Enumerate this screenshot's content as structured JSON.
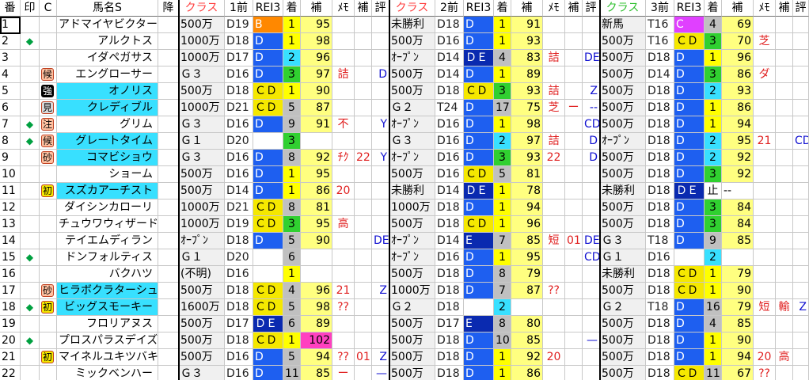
{
  "sheet": {
    "header": [
      "番",
      "印",
      "C",
      "馬名S",
      "降",
      "クラス",
      "1前",
      "REI3",
      "着",
      "補",
      "ﾒﾓ",
      "補",
      "評",
      "クラス",
      "2前",
      "REI3",
      "着",
      "補",
      "ﾒﾓ",
      "補",
      "評",
      "クラス",
      "3前",
      "REI3",
      "着",
      "補",
      "ﾒﾓ",
      "補",
      "評"
    ],
    "rows": [
      [
        "1",
        "",
        "",
        "アドマイヤビクター",
        "",
        "500万",
        "D19",
        "B",
        "1",
        "95",
        "",
        "",
        "",
        "未勝利",
        "D18",
        "D",
        "1",
        "91",
        "",
        "",
        "",
        "新馬",
        "T16",
        "C",
        "4",
        "69",
        "",
        "",
        ""
      ],
      [
        "2",
        "◆",
        "",
        "アルクトス",
        "",
        "1000万",
        "D18",
        "D",
        "1",
        "98",
        "",
        "",
        "",
        "500万",
        "D16",
        "D",
        "1",
        "93",
        "",
        "",
        "",
        "500万",
        "T16",
        "ＣＤ",
        "3",
        "70",
        "芝",
        "",
        ""
      ],
      [
        "3",
        "",
        "",
        "イダペガサス",
        "",
        "1000万",
        "D17",
        "D",
        "2",
        "96",
        "",
        "",
        "",
        "ｵｰﾌﾟﾝ",
        "D14",
        "ＤＥ",
        "4",
        "83",
        "詰",
        "",
        "DE",
        "500万",
        "D18",
        "D",
        "1",
        "96",
        "",
        "",
        ""
      ],
      [
        "4",
        "",
        "候",
        "エングローサー",
        "",
        "Ｇ３",
        "D16",
        "D",
        "3",
        "97",
        "詰",
        "",
        "D",
        "500万",
        "D14",
        "D",
        "1",
        "89",
        "",
        "",
        "",
        "500万",
        "D14",
        "D",
        "3",
        "86",
        "ダ",
        "",
        ""
      ],
      [
        "5",
        "",
        "強",
        "オノリス",
        "",
        "500万",
        "D18",
        "ＣＤ",
        "1",
        "90",
        "",
        "",
        "",
        "500万",
        "D18",
        "ＣＤ",
        "3",
        "93",
        "詰",
        "",
        "Z",
        "500万",
        "D18",
        "D",
        "2",
        "93",
        "",
        "",
        ""
      ],
      [
        "6",
        "",
        "見",
        "クレディブル",
        "",
        "1000万",
        "D21",
        "ＣＤ",
        "5",
        "87",
        "",
        "",
        "",
        "Ｇ２",
        "T24",
        "D",
        "17",
        "75",
        "芝",
        "ー",
        "--",
        "500万",
        "D18",
        "D",
        "1",
        "86",
        "",
        "",
        ""
      ],
      [
        "7",
        "◆",
        "注",
        "グリム",
        "",
        "Ｇ３",
        "D16",
        "D",
        "9",
        "91",
        "不",
        "",
        "Y",
        "ｵｰﾌﾟﾝ",
        "D16",
        "D",
        "1",
        "98",
        "",
        "",
        "CD",
        "500万",
        "D18",
        "D",
        "1",
        "94",
        "",
        "",
        ""
      ],
      [
        "8",
        "◆",
        "候",
        "グレートタイム",
        "",
        "Ｇ１",
        "D20",
        "",
        "3",
        "",
        "",
        "",
        "",
        "Ｇ３",
        "D16",
        "D",
        "2",
        "97",
        "詰",
        "",
        "D",
        "ｵｰﾌﾟﾝ",
        "D18",
        "D",
        "2",
        "95",
        "21",
        "",
        "CD"
      ],
      [
        "9",
        "",
        "砂",
        "コマビショウ",
        "",
        "Ｇ３",
        "D16",
        "D",
        "8",
        "92",
        "ﾁｸ",
        "22",
        "Y",
        "ｵｰﾌﾟﾝ",
        "D16",
        "D",
        "3",
        "93",
        "22",
        "",
        "D",
        "500万",
        "D18",
        "D",
        "2",
        "92",
        "",
        "",
        ""
      ],
      [
        "10",
        "",
        "",
        "ショーム",
        "",
        "500万",
        "D16",
        "D",
        "1",
        "95",
        "",
        "",
        "",
        "500万",
        "D16",
        "ＣＤ",
        "5",
        "81",
        "",
        "",
        "",
        "500万",
        "D18",
        "D",
        "3",
        "92",
        "",
        "",
        ""
      ],
      [
        "11",
        "",
        "初",
        "スズカアーチスト",
        "",
        "500万",
        "D14",
        "D",
        "1",
        "86",
        "20",
        "",
        "",
        "未勝利",
        "D14",
        "ＤＥ",
        "1",
        "78",
        "",
        "",
        "",
        "未勝利",
        "D18",
        "ＤＥ",
        "止",
        "--",
        "",
        "",
        ""
      ],
      [
        "12",
        "",
        "",
        "ダイシンカローリ",
        "",
        "1000万",
        "D21",
        "ＣＤ",
        "8",
        "81",
        "",
        "",
        "",
        "1000万",
        "D18",
        "D",
        "1",
        "94",
        "",
        "",
        "",
        "500万",
        "D18",
        "D",
        "3",
        "84",
        "",
        "",
        ""
      ],
      [
        "13",
        "",
        "",
        "チュウワウィザード",
        "",
        "1000万",
        "D19",
        "ＣＤ",
        "3",
        "95",
        "高",
        "",
        "",
        "500万",
        "D18",
        "ＣＤ",
        "1",
        "96",
        "",
        "",
        "",
        "500万",
        "D18",
        "D",
        "3",
        "84",
        "",
        "",
        ""
      ],
      [
        "14",
        "",
        "",
        "テイエムディラン",
        "",
        "ｵｰﾌﾟﾝ",
        "D18",
        "D",
        "5",
        "90",
        "",
        "",
        "DE",
        "ｵｰﾌﾟﾝ",
        "D14",
        "E",
        "7",
        "85",
        "短",
        "01",
        "DE",
        "Ｇ３",
        "T18",
        "D",
        "9",
        "85",
        "",
        "",
        ""
      ],
      [
        "15",
        "◆",
        "",
        "ドンフォルティス",
        "",
        "Ｇ１",
        "D20",
        "",
        "6",
        "",
        "",
        "",
        "",
        "ｵｰﾌﾟﾝ",
        "D16",
        "D",
        "1",
        "95",
        "",
        "",
        "CD",
        "Ｇ１",
        "D16",
        "",
        "2",
        "",
        "",
        "",
        ""
      ],
      [
        "16",
        "",
        "",
        "バクハツ",
        "",
        "(不明)",
        "D16",
        "",
        "1",
        "",
        "",
        "",
        "",
        "500万",
        "D18",
        "D",
        "8",
        "79",
        "",
        "",
        "",
        "未勝利",
        "D18",
        "ＣＤ",
        "1",
        "79",
        "",
        "",
        ""
      ],
      [
        "17",
        "",
        "砂",
        "ヒラボクラターシュ",
        "",
        "500万",
        "D18",
        "ＣＤ",
        "4",
        "96",
        "21",
        "",
        "Z",
        "1000万",
        "D18",
        "D",
        "7",
        "87",
        "??",
        "",
        "",
        "500万",
        "D18",
        "ＣＤ",
        "1",
        "90",
        "",
        "",
        ""
      ],
      [
        "18",
        "◆",
        "初",
        "ビッグスモーキー",
        "",
        "1600万",
        "D18",
        "ＣＤ",
        "5",
        "98",
        "??",
        "",
        "",
        "Ｇ２",
        "D18",
        "",
        "2",
        "",
        "",
        "",
        "",
        "Ｇ２",
        "T18",
        "D",
        "16",
        "79",
        "短",
        "輸",
        "Z"
      ],
      [
        "19",
        "",
        "",
        "フロリアヌス",
        "",
        "500万",
        "D17",
        "ＤＥ",
        "6",
        "89",
        "",
        "",
        "",
        "500万",
        "D17",
        "E",
        "8",
        "80",
        "",
        "",
        "",
        "500万",
        "D18",
        "D",
        "4",
        "85",
        "",
        "",
        ""
      ],
      [
        "20",
        "◆",
        "",
        "プロスパラスデイズ",
        "",
        "500万",
        "D18",
        "ＣＤ",
        "1",
        "102",
        "",
        "",
        "",
        "500万",
        "D18",
        "D",
        "10",
        "85",
        "",
        "",
        "—",
        "500万",
        "D18",
        "D",
        "1",
        "90",
        "",
        "",
        ""
      ],
      [
        "21",
        "",
        "初",
        "マイネルユキツバキ",
        "",
        "500万",
        "D16",
        "D",
        "5",
        "94",
        "??",
        "01",
        "Z",
        "500万",
        "D18",
        "D",
        "1",
        "92",
        "20",
        "",
        "",
        "500万",
        "D18",
        "D",
        "1",
        "94",
        "20",
        "高",
        ""
      ],
      [
        "22",
        "",
        "",
        "ミックベンハー",
        "",
        "Ｇ３",
        "D16",
        "D",
        "11",
        "85",
        "ー",
        "",
        "—",
        "500万",
        "D18",
        "D",
        "1",
        "86",
        "",
        "",
        "",
        "500万",
        "D18",
        "ＣＤ",
        "11",
        "67",
        "??",
        "",
        ""
      ]
    ]
  },
  "palette": {
    "class_bg": "#f0f0f0",
    "class_hdr": "#ff4040",
    "rei_D": "#1e5ff0",
    "rei_CD": "#f5e800",
    "rei_DE": "#0a2ab0",
    "rei_E": "#0a2ab0",
    "rei_B": "#ff8800",
    "rei_C": "#e040ff",
    "chaku_1": "#ffff00",
    "chaku_2": "#38e0ff",
    "chaku_3": "#30d030",
    "chaku_other": "#c0c0c0",
    "ho_bg": "#ffff80",
    "ho_high": "#ff40c0",
    "name_bg": "#38e0ff",
    "name_bg_alt": "#ffffff",
    "memo_red": "#e02020",
    "memo_blue": "#1010d0",
    "symbol_green": "#00a040"
  }
}
